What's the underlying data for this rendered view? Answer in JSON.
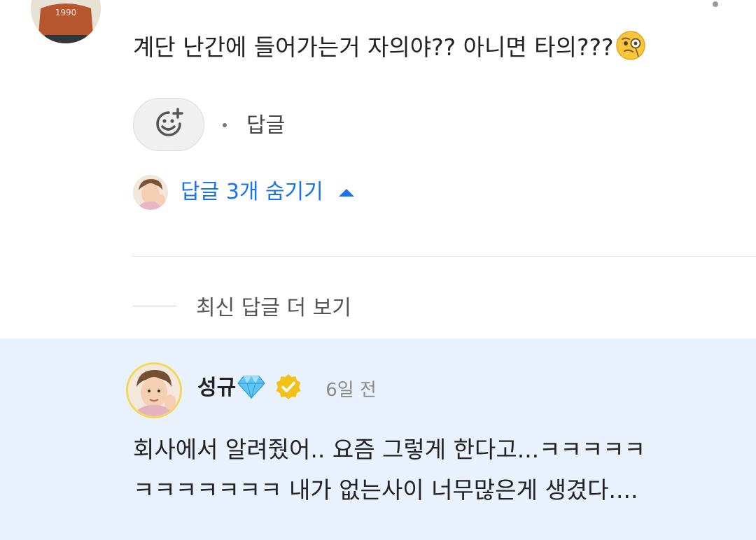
{
  "top_comment": {
    "text": "계단 난간에 들어가는거 자의야?? 아니면 타의???",
    "emoji": "face-with-monocle"
  },
  "actions": {
    "add_reaction_icon": "add-reaction-smiley-icon",
    "reply_label": "답글"
  },
  "replies_toggle": {
    "label": "답글 3개 숨기기",
    "icon": "caret-up-icon",
    "color": "#1a73e8"
  },
  "more_replies": {
    "label": "최신 답글 더 보기"
  },
  "highlighted_reply": {
    "background": "#e9f1fc",
    "author": "성규",
    "badges": [
      "diamond-icon",
      "verified-icon"
    ],
    "time": "6일 전",
    "lines": [
      "회사에서 알려줬어.. 요즘 그렇게 한다고...ㅋㅋㅋㅋㅋ",
      "ㅋㅋㅋㅋㅋㅋㅋ 내가 없는사이 너무많은게 생겼다...."
    ]
  }
}
